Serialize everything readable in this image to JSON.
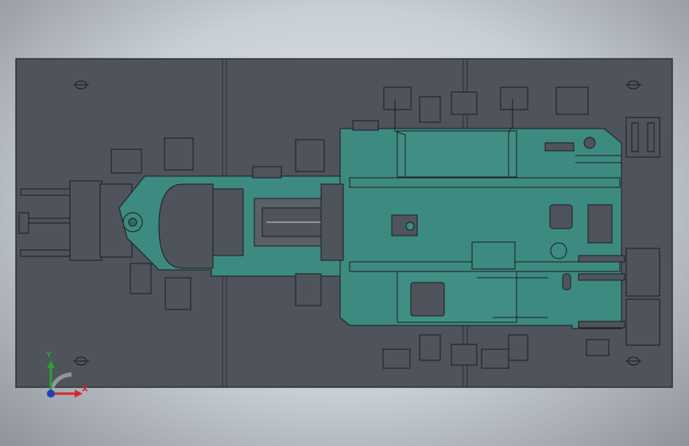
{
  "viewport": {
    "background": "#c9cfd6",
    "plate_color": "#4e535c",
    "plate_edge": "#1c1f24",
    "body_color": "#3d8a80",
    "line_color": "#1a1d22",
    "highlight": "#cfd6d8"
  },
  "triad": {
    "y_label": "Y",
    "x_label": "X",
    "y_color": "#2ca02c",
    "x_color": "#d62728",
    "z_color": "#1f3fbf",
    "icon": "coordinate-triad-icon"
  }
}
